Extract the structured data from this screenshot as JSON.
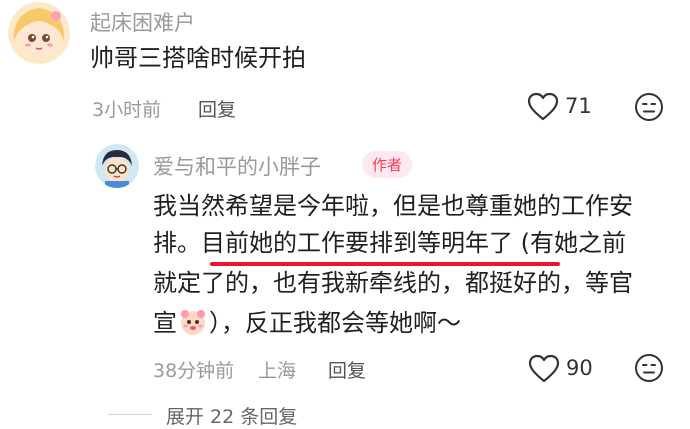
{
  "comment1": {
    "username": "起床困难户",
    "text": "帅哥三搭啥时候开拍",
    "time": "3小时前",
    "reply_label": "回复",
    "likes": "71"
  },
  "comment2": {
    "username": "爱与和平的小胖子",
    "author_badge": "作者",
    "lines": [
      "我当然希望是今年啦，但是也尊重她的工作安",
      "排。目前她的工作要排到等明年了 (有她之前",
      "就定了的，也有我新牵线的，都挺好的，等官",
      "），反正我都会等她啊～"
    ],
    "line4_prefix": "宣",
    "time": "38分钟前",
    "location": "上海",
    "reply_label": "回复",
    "likes": "90"
  },
  "expand": {
    "label": "展开 22 条回复"
  },
  "colors": {
    "highlight_underline": "#e8152d",
    "badge_text": "#ff3b5c",
    "badge_bg": "#ffe9ee"
  },
  "icons": [
    "heart-outline-icon",
    "smiley-icon",
    "sticker-emoji-icon"
  ]
}
